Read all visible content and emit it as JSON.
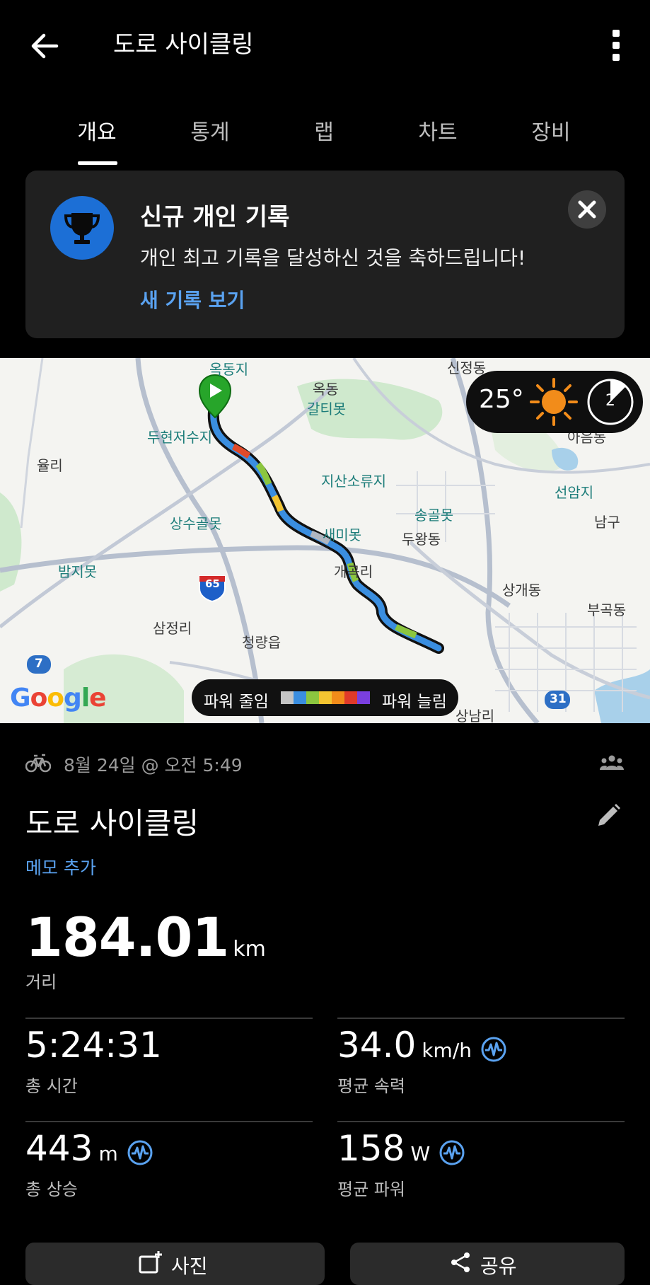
{
  "header": {
    "title": "도로 사이클링"
  },
  "tabs": [
    {
      "label": "개요",
      "active": true
    },
    {
      "label": "통계"
    },
    {
      "label": "랩"
    },
    {
      "label": "차트"
    },
    {
      "label": "장비"
    }
  ],
  "record_card": {
    "title": "신규 개인 기록",
    "message": "개인 최고 기록을 달성하신 것을 축하드립니다!",
    "link": "새 기록 보기"
  },
  "map": {
    "temperature": "25°",
    "wind_level": "2",
    "legend_low": "파워 줄임",
    "legend_high": "파워 늘림",
    "provider": "Google",
    "labels": {
      "l1": "옥동지",
      "l2": "신정동",
      "l3": "옥동",
      "l4": "갈티못",
      "l5": "두현저수지",
      "l6": "아음동",
      "l7": "율리",
      "l8": "지산소류지",
      "l9": "선암지",
      "l10": "송골못",
      "l11": "남구",
      "l12": "상수골못",
      "l13": "새미못",
      "l14": "두왕동",
      "l15": "밤지못",
      "l16": "개곡리",
      "l17": "상개동",
      "l18": "부곡동",
      "l19": "삼정리",
      "l20": "청량읍",
      "l21": "상남리",
      "r65": "65",
      "r7": "7",
      "r31": "31"
    },
    "colors": {
      "route_base": "#3a8ee0",
      "start": "#27a52a"
    }
  },
  "activity": {
    "date": "8월 24일 @ 오전 5:49",
    "title": "도로 사이클링",
    "memo": "메모 추가",
    "distance": {
      "value": "184.01",
      "unit": "km",
      "label": "거리"
    },
    "stats": {
      "time": {
        "value": "5:24:31",
        "label": "총 시간"
      },
      "speed": {
        "value": "34.0",
        "unit": "km/h",
        "label": "평균 속력"
      },
      "ascent": {
        "value": "443",
        "unit": "m",
        "label": "총 상승"
      },
      "power": {
        "value": "158",
        "unit": "W",
        "label": "평균 파워"
      }
    }
  },
  "buttons": {
    "photo": "사진",
    "share": "공유"
  },
  "theme": {
    "accent": "#5aa2f0",
    "trophy_bg": "#1c6fd6",
    "card_bg": "#202020"
  }
}
